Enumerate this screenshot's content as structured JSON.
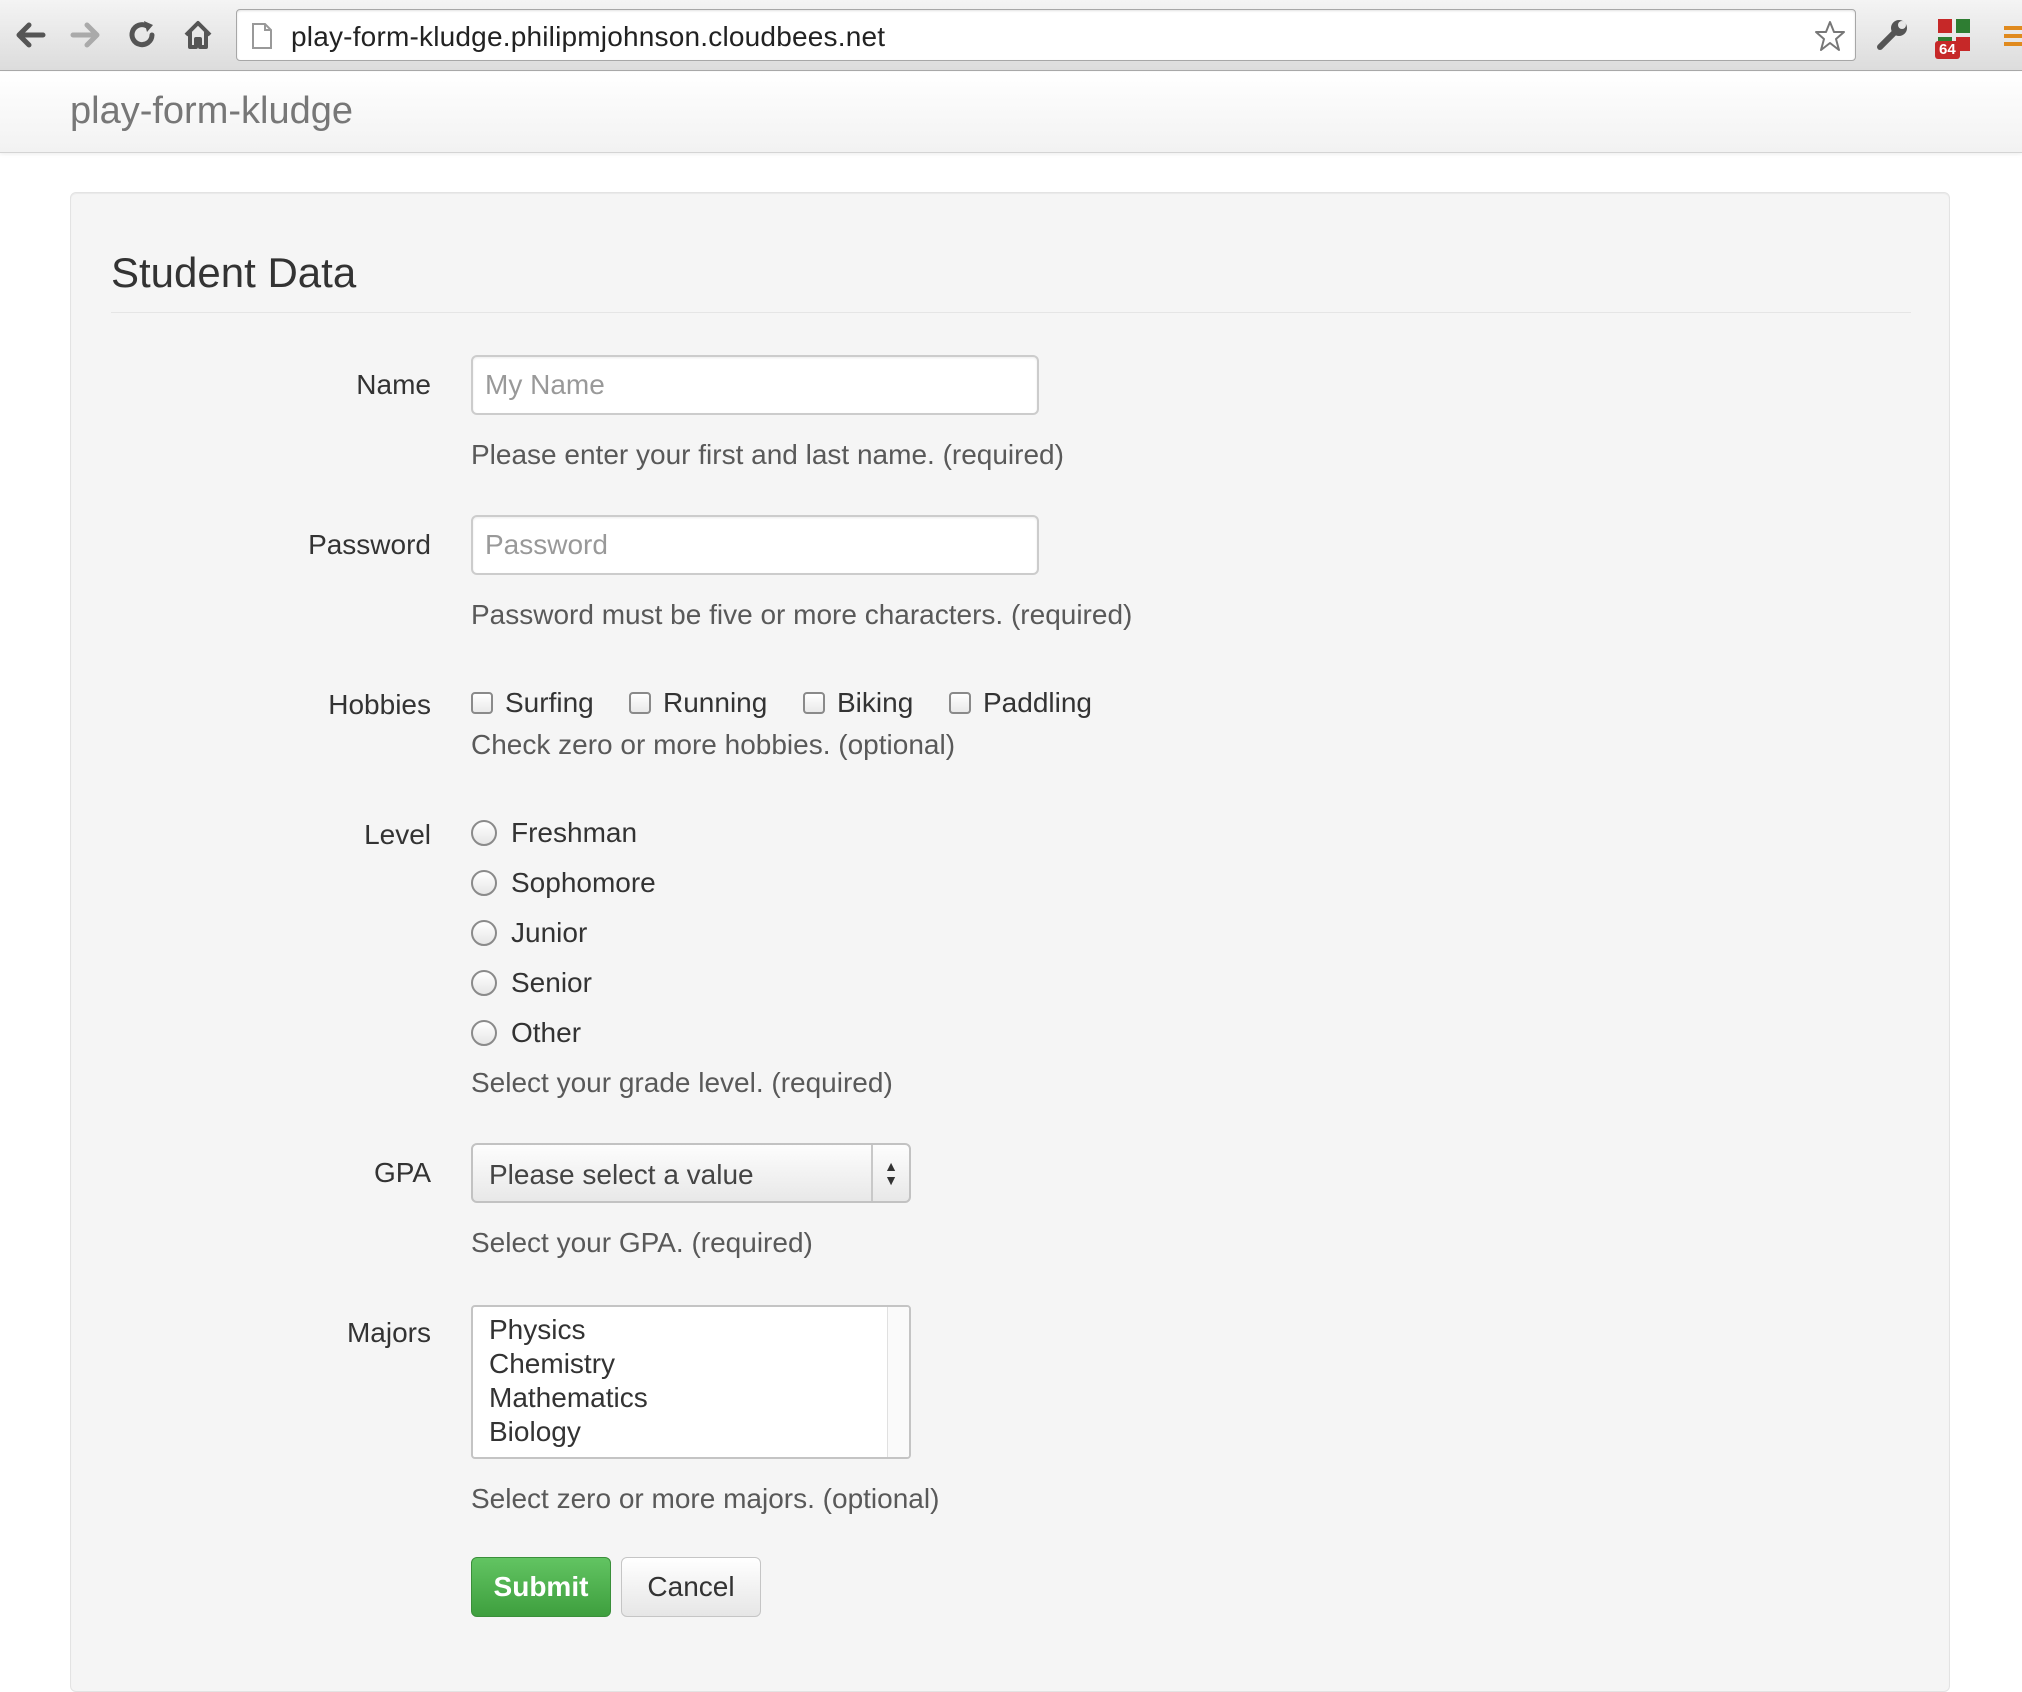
{
  "browser": {
    "url": "play-form-kludge.philipmjohnson.cloudbees.net",
    "extension_badge": "64"
  },
  "navbar": {
    "brand": "play-form-kludge"
  },
  "form": {
    "title": "Student Data",
    "name": {
      "label": "Name",
      "placeholder": "My Name",
      "help": "Please enter your first and last name. (required)"
    },
    "password": {
      "label": "Password",
      "placeholder": "Password",
      "help": "Password must be five or more characters. (required)"
    },
    "hobbies": {
      "label": "Hobbies",
      "options": [
        "Surfing",
        "Running",
        "Biking",
        "Paddling"
      ],
      "help": "Check zero or more hobbies. (optional)"
    },
    "level": {
      "label": "Level",
      "options": [
        "Freshman",
        "Sophomore",
        "Junior",
        "Senior",
        "Other"
      ],
      "help": "Select your grade level. (required)"
    },
    "gpa": {
      "label": "GPA",
      "selected": "Please select a value",
      "help": "Select your GPA. (required)"
    },
    "majors": {
      "label": "Majors",
      "options": [
        "Physics",
        "Chemistry",
        "Mathematics",
        "Biology"
      ],
      "help": "Select zero or more majors. (optional)"
    },
    "buttons": {
      "submit": "Submit",
      "cancel": "Cancel"
    }
  },
  "colors": {
    "submit_green": "#51a351",
    "well_background": "#f5f5f5"
  }
}
